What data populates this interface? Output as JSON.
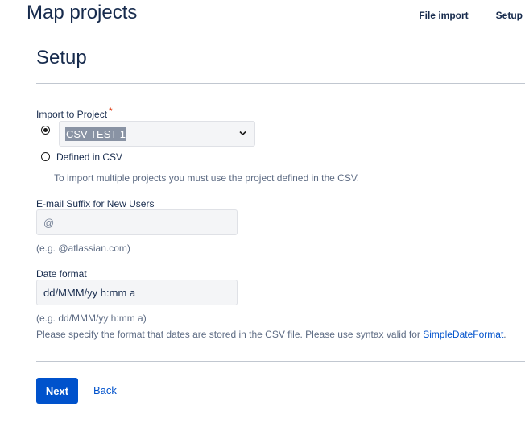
{
  "header": {
    "title": "Map projects",
    "nav": [
      "File import",
      "Setup"
    ]
  },
  "section": {
    "title": "Setup"
  },
  "form": {
    "import_label": "Import to Project",
    "required_mark": "*",
    "project_select": {
      "value": "CSV TEST 1",
      "selected": true
    },
    "defined_in_csv_label": "Defined in CSV",
    "defined_in_csv_hint": "To import multiple projects you must use the project defined in the CSV.",
    "email_label": "E-mail Suffix for New Users",
    "email_placeholder": "@",
    "email_hint": "(e.g. @atlassian.com)",
    "date_label": "Date format",
    "date_value": "dd/MMM/yy h:mm a",
    "date_hint": "(e.g. dd/MMM/yy h:mm a)",
    "date_desc": "Please specify the format that dates are stored in the CSV file. Please use syntax valid for ",
    "date_link": "SimpleDateFormat",
    "date_desc_end": "."
  },
  "actions": {
    "next": "Next",
    "back": "Back"
  },
  "colors": {
    "primary": "#0052cc",
    "text": "#172b4d",
    "required": "#de350b"
  }
}
